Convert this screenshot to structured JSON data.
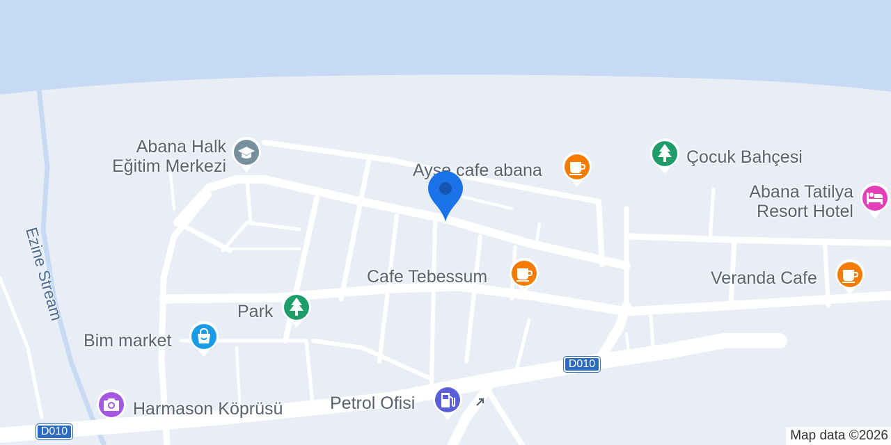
{
  "colors": {
    "land": "#e9edf6",
    "water": "#c6dbf3",
    "road": "#ffffff",
    "label_text": "#5a6270",
    "route_badge": "#2d6bbf",
    "marker": "#1a73e8",
    "poi_orange": "#f57c00",
    "poi_green": "#1e9c6a",
    "poi_grey": "#78909c",
    "poi_blue": "#1a9be6",
    "poi_purple": "#a259e0",
    "poi_pink": "#e53fb8",
    "poi_fuel": "#5a5fd8"
  },
  "water": {
    "stream_name": "Ezine Stream"
  },
  "marker": {
    "icon": "location-pin-icon"
  },
  "pois": [
    {
      "id": "abana-halk",
      "lines": [
        "Abana Halk",
        "Eğitim Merkezi"
      ],
      "icon": "graduation-cap-icon",
      "color": "poi_grey"
    },
    {
      "id": "ayse-cafe",
      "lines": [
        "Ayşe cafe abana"
      ],
      "icon": "coffee-cup-icon",
      "color": "poi_orange"
    },
    {
      "id": "cocuk-bahcesi",
      "lines": [
        "Çocuk Bahçesi"
      ],
      "icon": "tree-icon",
      "color": "poi_green"
    },
    {
      "id": "abana-tatilya",
      "lines": [
        "Abana Tatilya",
        "Resort Hotel"
      ],
      "icon": "bed-icon",
      "color": "poi_pink"
    },
    {
      "id": "cafe-tebessum",
      "lines": [
        "Cafe Tebessum"
      ],
      "icon": "coffee-cup-icon",
      "color": "poi_orange"
    },
    {
      "id": "veranda-cafe",
      "lines": [
        "Veranda Cafe"
      ],
      "icon": "coffee-cup-icon",
      "color": "poi_orange"
    },
    {
      "id": "park",
      "lines": [
        "Park"
      ],
      "icon": "tree-icon",
      "color": "poi_green"
    },
    {
      "id": "bim-market",
      "lines": [
        "Bim market"
      ],
      "icon": "shopping-bag-icon",
      "color": "poi_blue"
    },
    {
      "id": "harmason",
      "lines": [
        "Harmason Köprüsü"
      ],
      "icon": "camera-icon",
      "color": "poi_purple"
    },
    {
      "id": "petrol-ofisi",
      "lines": [
        "Petrol Ofisi"
      ],
      "icon": "fuel-pump-icon",
      "color": "poi_fuel"
    }
  ],
  "routes": [
    {
      "id": "d010-east",
      "label": "D010"
    },
    {
      "id": "d010-west",
      "label": "D010"
    }
  ],
  "attribution": "Map data ©2026"
}
